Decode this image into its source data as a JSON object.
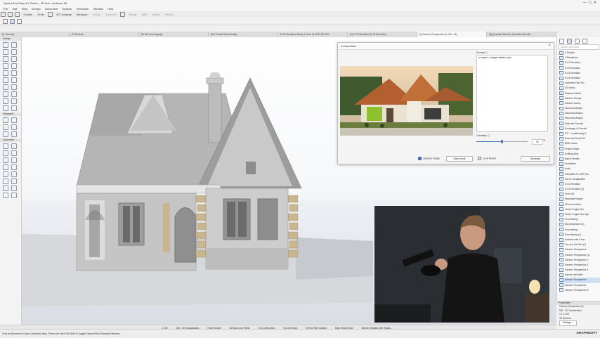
{
  "window": {
    "title": "Speed Run Early XX Gothic - 3D test - Archicad 26"
  },
  "menu": [
    "File",
    "Edit",
    "View",
    "Design",
    "Document",
    "Options",
    "Teamwork",
    "Window",
    "Help"
  ],
  "toolbar": [
    "Guides",
    "Grids",
    "3D Cutaway",
    "Measure",
    "Group",
    "Suspend",
    "Merge",
    "Split",
    "Adjust",
    "Modify..."
  ],
  "tabs": [
    "[0. Ground]",
    "[F Section]",
    "[W-W2 (unmerged)]",
    "[3rd Portrait Thumbnails]",
    "E-02 Elevation Study (1 June at 12:00 (E0 0M...",
    "(1) E-02 Elevation (E-02 Elevation)",
    "[2] Generic Perspective (0.130 / 44)",
    "[3] Quantity Takeoff (- Quantity Takeoff)"
  ],
  "toolbox": {
    "sections": [
      {
        "title": "Design",
        "count": 20
      },
      {
        "title": "Viewpoint",
        "count": 6
      },
      {
        "title": "Document",
        "count": 16
      }
    ]
  },
  "navigator": {
    "search_placeholder": "Search View Map",
    "items": [
      "3 Section",
      "3 Elevations",
      "E-01 Elevation",
      "E-02 Elevation",
      "E-03 Elevation",
      "E-04 Elevation",
      "Overview Plan Flo",
      "3D Views",
      "Physical Model",
      "Generic Perspe",
      "Generic Axono",
      "Structural Analyt",
      "Structural Analys",
      "Structural Analys",
      "Slab and Founda",
      "Exchange & Coordin",
      "IFC - Loadbearing S",
      "Zone and Morph M",
      "BIMx Views",
      "Project Notes",
      "Drafting Aids",
      "Batch Render",
      "Schedules",
      "Audit",
      "GROUND FLOOR Pla",
      "3D-00 Visualization",
      "E-01 Elevation",
      "E-02 Elevation (1)",
      "Front 3D",
      "Historical Engine",
      "3D Axonometry",
      "Vector Engine Sur",
      "Vector Engine Sur Ngt",
      "Front facing",
      "3D perspective (s)",
      "Front facing",
      "Front facing (1)",
      "Ambient with Crew",
      "Top-out 1st View (1)",
      "Generic Perspective",
      "Generic Perspective (1)",
      "Generic Perspective 2",
      "Generic Perspective 3",
      "Generic Perspective 4",
      "Interior with table",
      "Generic Perspective",
      "Generic Perspective",
      "Generic Perspective 8"
    ]
  },
  "dialog": {
    "title": "AI Visualizer",
    "prompt_label": "Prompt",
    "prompt_text": "a modern cottage realistic style",
    "creativity_label": "Creativity",
    "creativity_value": "50",
    "creativity_unit": "%",
    "creativity_fraction": 0.5,
    "upscale_label": "Upscale image",
    "save_label": "Save result",
    "lock_label": "Lock Result",
    "generate_label": "Generate"
  },
  "quick_options": [
    "1:100",
    "100 - 3D Visualization",
    "Entire Model",
    "01 Black and White",
    "03 Construction",
    "No Overrides",
    "06 No Filter Applied",
    "Main Model Only",
    "Simple Shading with Shado..."
  ],
  "status": {
    "text": "Click an Element or Draw a Selection Area. Press and Hold Ctrl+Shift to Toggle Element/Sub-Element Selection."
  },
  "properties": {
    "title": "Properties",
    "lines": [
      "Generic Perspective (1)",
      "500 - 3D Visualization",
      "1:1 1:100",
      "3D Window",
      "Settings..."
    ]
  },
  "brand": "GRAPHISOFT",
  "colors": {
    "accent": "#3a74c8",
    "viewport_bg": "#ffffff",
    "roof": "#9a9a9a",
    "walls": "#b8b8b8",
    "stone": "#c9b58e"
  }
}
